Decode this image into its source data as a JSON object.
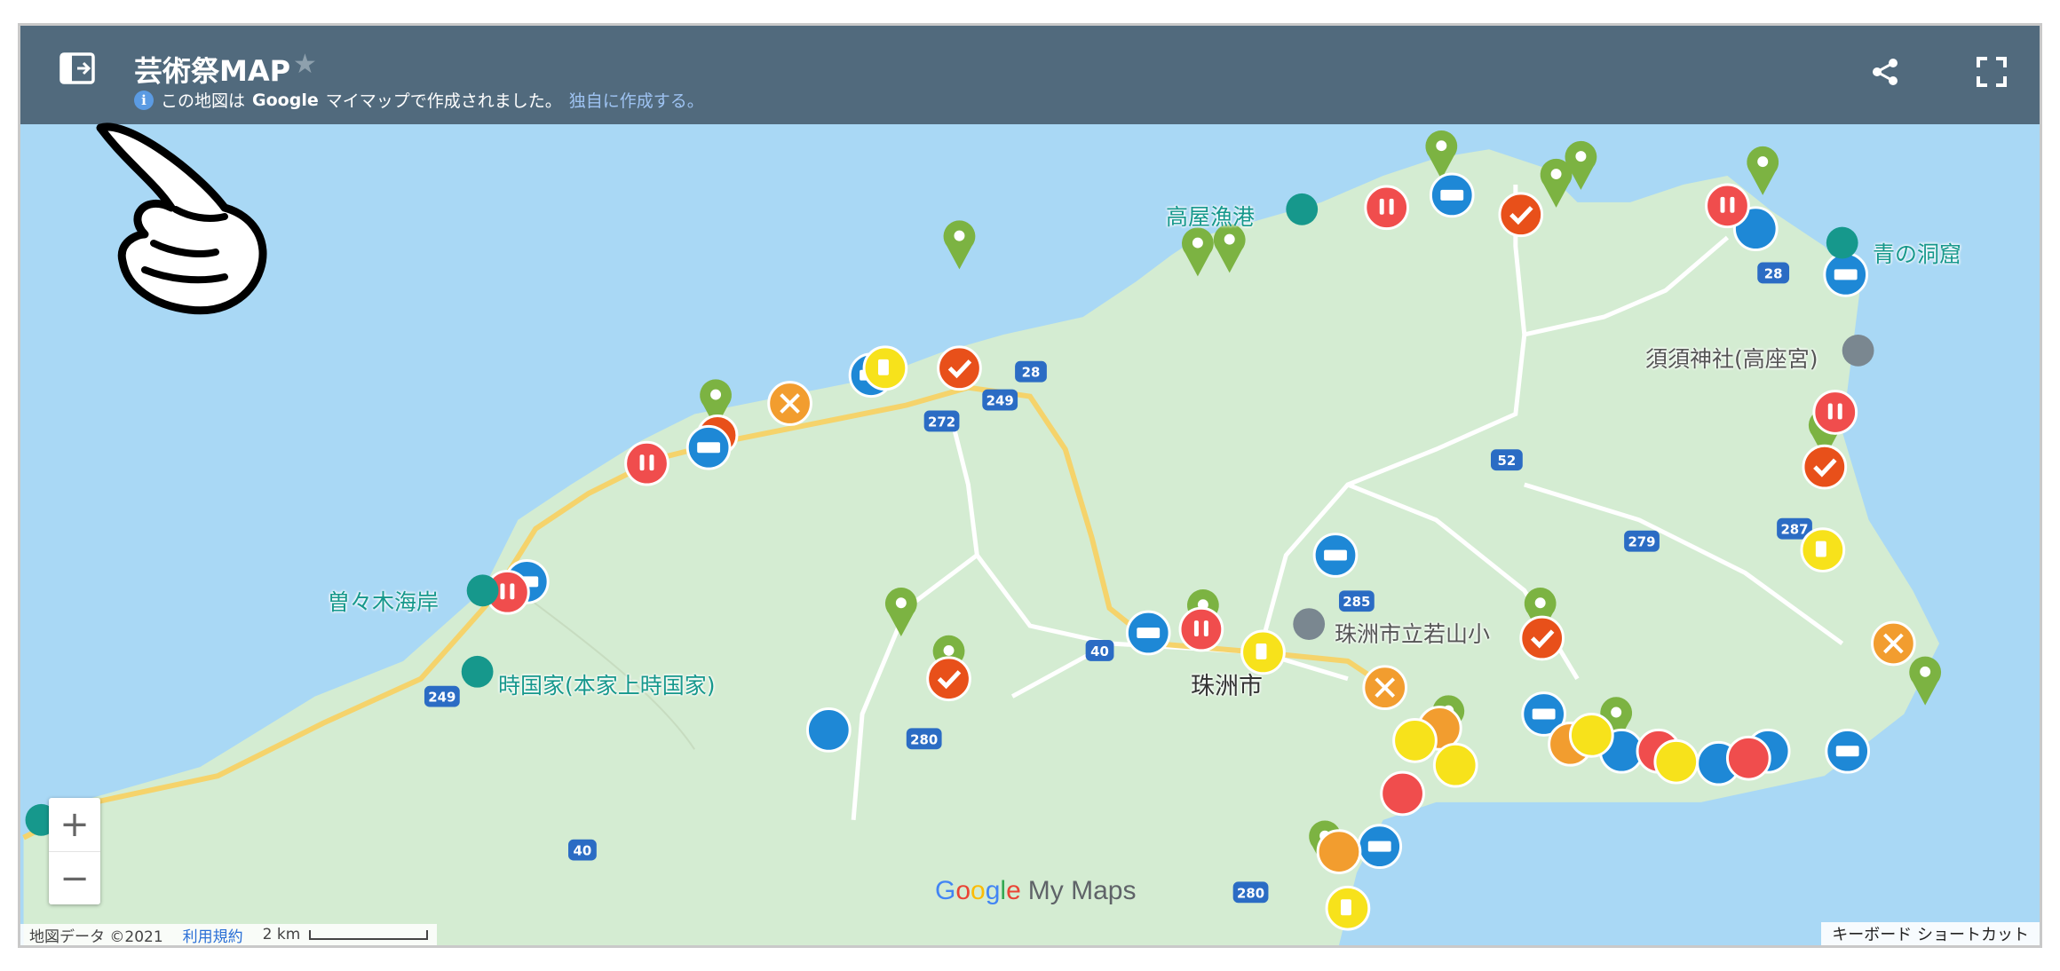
{
  "header": {
    "title": "芸術祭MAP",
    "info_prefix": "この地図は ",
    "info_brand": "Google",
    "info_suffix": " マイマップで作成されました。",
    "create_link": "独自に作成する。"
  },
  "places": [
    {
      "name": "高屋漁港"
    },
    {
      "name": "青の洞窟"
    },
    {
      "name": "須須神社(高座宮)"
    },
    {
      "name": "曽々木海岸"
    },
    {
      "name": "時国家(本家上時国家)"
    },
    {
      "name": "珠洲市立若山小"
    },
    {
      "name": "珠洲市"
    }
  ],
  "routes": [
    "28",
    "249",
    "272",
    "52",
    "279",
    "287",
    "285",
    "40",
    "280",
    "40",
    "280",
    "249",
    "28"
  ],
  "footer": {
    "attribution": "地図データ ©2021",
    "terms": "利用規約",
    "scale": "2 km",
    "shortcuts": "キーボード ショートカット"
  },
  "logo": {
    "google": "Google",
    "product": "My Maps"
  },
  "colors": {
    "header": "#516a7d",
    "water": "#a9d8f5",
    "land": "#d4ecd2",
    "pin_green": "#7cb342",
    "marker_blue": "#1e88d6",
    "marker_red": "#f04d4d",
    "marker_orange": "#f29d2f",
    "marker_yellow": "#f7e21b",
    "marker_check": "#e8501a"
  },
  "icons": [
    "sidebar-toggle-icon",
    "share-icon",
    "fullscreen-icon",
    "star-icon",
    "info-icon",
    "pointing-hand-icon"
  ]
}
